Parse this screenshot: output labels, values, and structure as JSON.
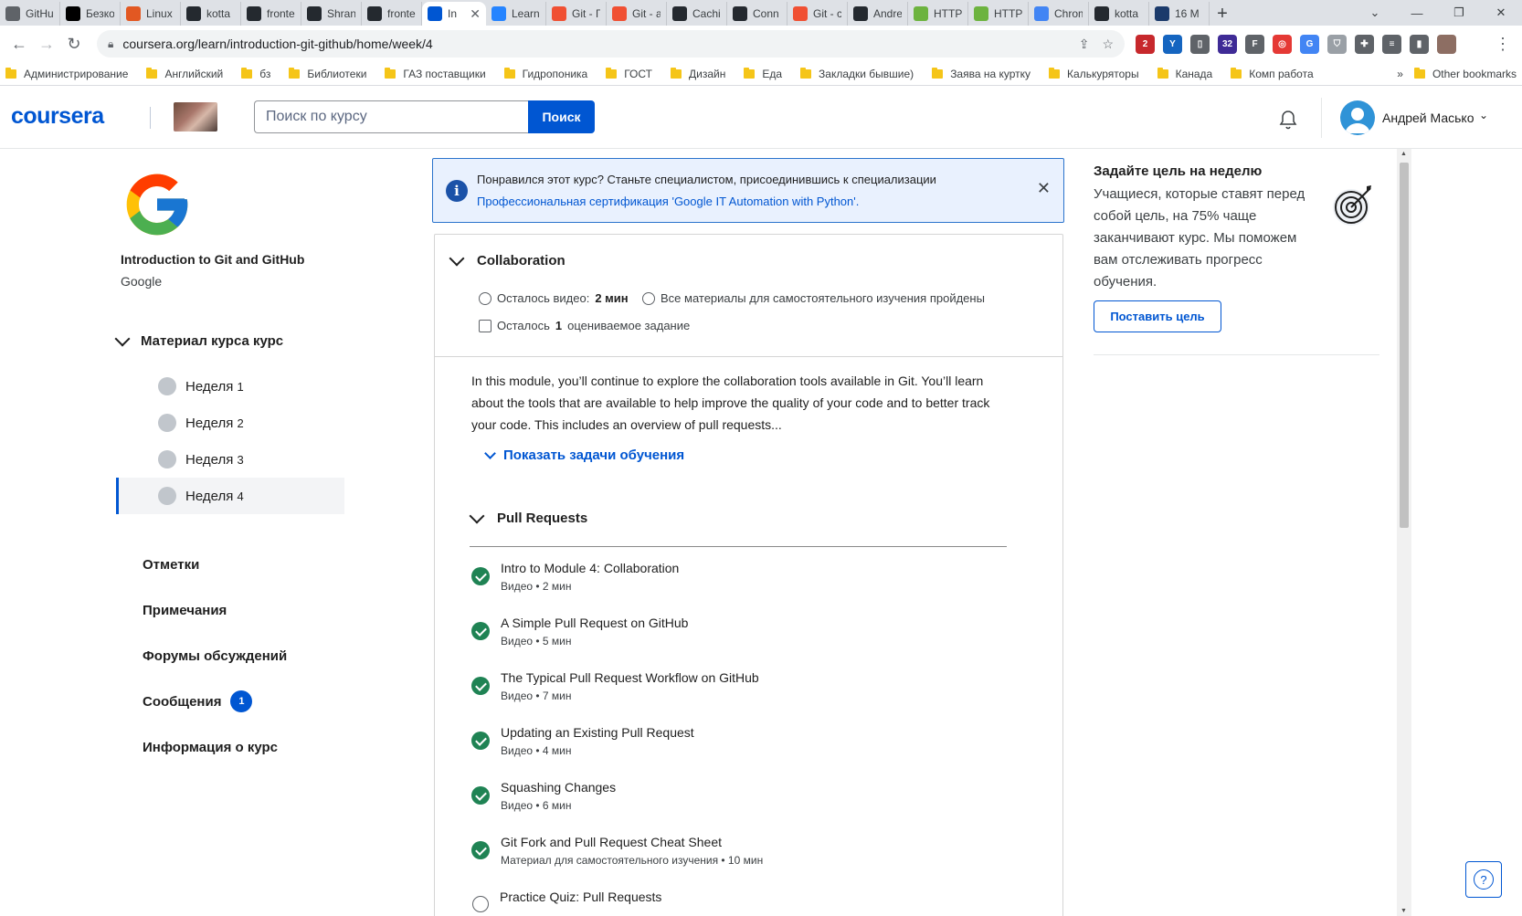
{
  "browser": {
    "tabs": [
      {
        "label": "GitHu",
        "icon": "github-icon",
        "color": "#5f6368"
      },
      {
        "label": "Безко",
        "icon": "dou-icon",
        "color": "#000000"
      },
      {
        "label": "Linux",
        "icon": "linux-icon",
        "color": "#e25822"
      },
      {
        "label": "kotta",
        "icon": "github-icon",
        "color": "#24292f"
      },
      {
        "label": "fronte",
        "icon": "github-icon",
        "color": "#24292f"
      },
      {
        "label": "Shran",
        "icon": "github-icon",
        "color": "#24292f"
      },
      {
        "label": "fronte",
        "icon": "github-icon",
        "color": "#24292f"
      },
      {
        "label": "In",
        "icon": "coursera-icon",
        "color": "#0056d2",
        "active": true
      },
      {
        "label": "Learn",
        "icon": "atlassian-icon",
        "color": "#2684ff"
      },
      {
        "label": "Git - Г",
        "icon": "git-icon",
        "color": "#f05033"
      },
      {
        "label": "Git - а",
        "icon": "git-icon",
        "color": "#f05033"
      },
      {
        "label": "Cachi",
        "icon": "github-icon",
        "color": "#24292f"
      },
      {
        "label": "Conn",
        "icon": "github-icon",
        "color": "#24292f"
      },
      {
        "label": "Git - с",
        "icon": "git-icon",
        "color": "#f05033"
      },
      {
        "label": "Andre",
        "icon": "github-icon",
        "color": "#24292f"
      },
      {
        "label": "HTTP",
        "icon": "leaf-icon",
        "color": "#6db33f"
      },
      {
        "label": "HTTP",
        "icon": "leaf-icon",
        "color": "#6db33f"
      },
      {
        "label": "Chrom",
        "icon": "chrome-icon",
        "color": "#4285f4"
      },
      {
        "label": "kotta",
        "icon": "github-icon",
        "color": "#24292f"
      },
      {
        "label": "16 M",
        "icon": "ds-icon",
        "color": "#1b3a6b"
      }
    ],
    "new_tab": "+",
    "url": "coursera.org/learn/introduction-git-github/home/week/4",
    "extensions": [
      {
        "name": "abp-icon",
        "color": "#c7282c",
        "text": "2"
      },
      {
        "name": "vpn-icon",
        "color": "#1565c0",
        "text": "Y"
      },
      {
        "name": "trash-icon",
        "color": "#5f6368",
        "text": "▯"
      },
      {
        "name": "grad-icon",
        "color": "#3f2b96",
        "text": "32"
      },
      {
        "name": "f-icon",
        "color": "#5f6368",
        "text": "F"
      },
      {
        "name": "rss-icon",
        "color": "#e53935",
        "text": "◎"
      },
      {
        "name": "translate-icon",
        "color": "#4285f4",
        "text": "G"
      },
      {
        "name": "shield-icon",
        "color": "#9aa0a6",
        "text": "⛉"
      },
      {
        "name": "puzzle-icon",
        "color": "#5f6368",
        "text": "✚"
      },
      {
        "name": "list-icon",
        "color": "#5f6368",
        "text": "≡"
      },
      {
        "name": "sidepanel-icon",
        "color": "#5f6368",
        "text": "▮"
      },
      {
        "name": "profile-icon",
        "color": "#8d6e63",
        "text": ""
      }
    ],
    "bookmarks": [
      "Администрирование",
      "Английский",
      "бз",
      "Библиотеки",
      "ГАЗ поставщики",
      "Гидропоника",
      "ГОСТ",
      "Дизайн",
      "Еда",
      "Закладки бывшие)",
      "Заява на куртку",
      "Калькуряторы",
      "Канада",
      "Комп работа"
    ],
    "bookmarks_more": "»",
    "other_bookmarks": "Other bookmarks"
  },
  "header": {
    "logo": "coursera",
    "search_placeholder": "Поиск по курсу",
    "search_button": "Поиск",
    "user_name": "Андрей Масько"
  },
  "sidebar": {
    "course_title": "Introduction to Git and GitHub",
    "course_partner": "Google",
    "material_heading": "Материал курса курс",
    "weeks": [
      {
        "label": "Неделя",
        "num": "1"
      },
      {
        "label": "Неделя",
        "num": "2"
      },
      {
        "label": "Неделя",
        "num": "3"
      },
      {
        "label": "Неделя",
        "num": "4",
        "active": true
      }
    ],
    "links": [
      {
        "label": "Отметки"
      },
      {
        "label": "Примечания"
      },
      {
        "label": "Форумы обсуждений"
      },
      {
        "label": "Сообщения",
        "badge": "1"
      },
      {
        "label": "Информация о курс"
      }
    ]
  },
  "banner": {
    "line1": "Понравился этот курс? Станьте специалистом, присоединившись к специализации",
    "line2": "Профессиональная сертификация 'Google IT Automation with Python'."
  },
  "module": {
    "title": "Collaboration",
    "videos_left_prefix": "Осталось видео:",
    "videos_left_value": "2 мин",
    "self_study_done": "Все материалы для самостоятельного изучения пройдены",
    "graded_left_prefix": "Осталось",
    "graded_left_value": "1",
    "graded_left_suffix": "оцениваемое задание",
    "description": "In this module, you’ll continue to explore the collaboration tools available in Git. You’ll learn about the tools that are available to help improve the quality of your code and to better track your code. This includes an overview of pull requests...",
    "show_objectives": "Показать задачи обучения",
    "lesson_title": "Pull Requests",
    "items": [
      {
        "title": "Intro to Module 4: Collaboration",
        "sub": "Видео • 2 мин",
        "done": true
      },
      {
        "title": "A Simple Pull Request on GitHub",
        "sub": "Видео • 5 мин",
        "done": true
      },
      {
        "title": "The Typical Pull Request Workflow on GitHub",
        "sub": "Видео • 7 мин",
        "done": true
      },
      {
        "title": "Updating an Existing Pull Request",
        "sub": "Видео • 4 мин",
        "done": true
      },
      {
        "title": "Squashing Changes",
        "sub": "Видео • 6 мин",
        "done": true
      },
      {
        "title": "Git Fork and Pull Request Cheat Sheet",
        "sub": "Материал для самостоятельного изучения • 10 мин",
        "done": true
      },
      {
        "title": "Practice Quiz: Pull Requests",
        "sub": "",
        "done": false
      }
    ]
  },
  "goal": {
    "title": "Задайте цель на неделю",
    "text": "Учащиеся, которые ставят перед собой цель, на 75% чаще заканчивают курс. Мы поможем вам отслеживать прогресс обучения.",
    "button": "Поставить цель"
  },
  "help_label": "?"
}
